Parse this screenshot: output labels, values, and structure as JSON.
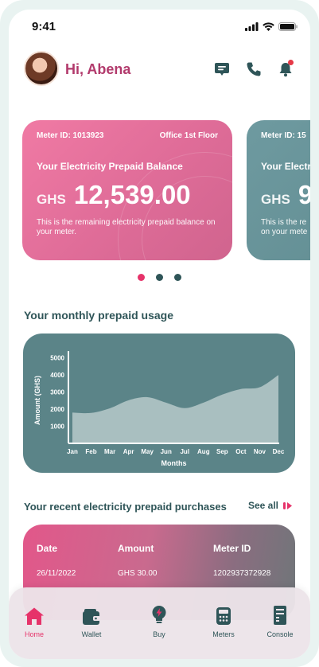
{
  "status_bar": {
    "time": "9:41"
  },
  "header": {
    "greeting": "Hi, Abena"
  },
  "balance_cards": [
    {
      "meter_id": "Meter ID: 1013923",
      "location": "Office 1st Floor",
      "title": "Your Electricity Prepaid Balance",
      "currency": "GHS",
      "amount": "12,539.00",
      "description": "This is the remaining electricity prepaid balance on your meter."
    },
    {
      "meter_id": "Meter ID: 15",
      "location": "",
      "title": "Your Electri",
      "currency": "GHS",
      "amount": "9",
      "description": "This is the re on your mete"
    }
  ],
  "carousel": {
    "count": 3,
    "active_index": 0
  },
  "usage_section": {
    "title": "Your monthly prepaid usage"
  },
  "chart_data": {
    "type": "area",
    "x": [
      "Jan",
      "Feb",
      "Mar",
      "Apr",
      "May",
      "Jun",
      "Jul",
      "Aug",
      "Sep",
      "Oct",
      "Nov",
      "Dec"
    ],
    "values": [
      1800,
      1780,
      2050,
      2520,
      2700,
      2380,
      2060,
      2380,
      2850,
      3180,
      3280,
      4000
    ],
    "xlabel": "Months",
    "ylabel": "Amount (GHS)",
    "yticks": [
      1000,
      2000,
      3000,
      4000,
      5000
    ],
    "ylim": [
      0,
      5400
    ],
    "grid": false
  },
  "purchases_section": {
    "title": "Your recent electricity prepaid purchases",
    "see_all": "See all",
    "columns": [
      "Date",
      "Amount",
      "Meter ID"
    ],
    "rows": [
      [
        "26/11/2022",
        "GHS 30.00",
        "1202937372928"
      ]
    ]
  },
  "tabbar": {
    "items": [
      {
        "label": "Home",
        "icon": "home-icon",
        "active": true
      },
      {
        "label": "Wallet",
        "icon": "wallet-icon",
        "active": false
      },
      {
        "label": "Buy",
        "icon": "bulb-icon",
        "active": false
      },
      {
        "label": "Meters",
        "icon": "meter-icon",
        "active": false
      },
      {
        "label": "Console",
        "icon": "console-icon",
        "active": false
      }
    ]
  },
  "colors": {
    "accent": "#e6336a",
    "primary_text": "#2f5558",
    "chart_bg": "#5b8488",
    "chart_area": "#a9bfc0",
    "greeting": "#b23a6c"
  }
}
